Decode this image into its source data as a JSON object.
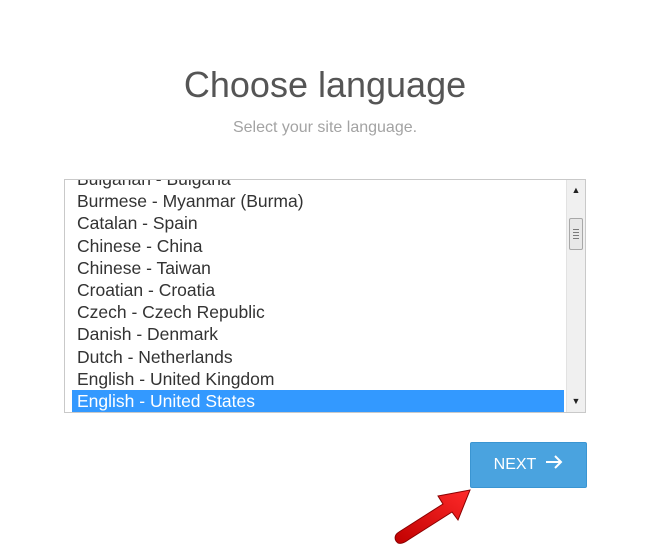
{
  "header": {
    "title": "Choose language",
    "subtitle": "Select your site language."
  },
  "language_list": {
    "options": [
      "Bulgarian - Bulgaria",
      "Burmese - Myanmar (Burma)",
      "Catalan - Spain",
      "Chinese - China",
      "Chinese - Taiwan",
      "Croatian - Croatia",
      "Czech - Czech Republic",
      "Danish - Denmark",
      "Dutch - Netherlands",
      "English - United Kingdom",
      "English - United States"
    ],
    "selected": "English - United States"
  },
  "actions": {
    "next_label": "NEXT",
    "next_icon": "arrow-right-icon"
  },
  "colors": {
    "selected_bg": "#3399ff",
    "button_bg": "#4aa3df",
    "annotation_arrow": "#e02020"
  }
}
